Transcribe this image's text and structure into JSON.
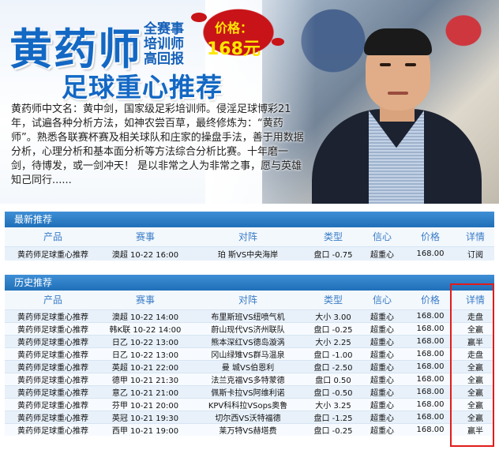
{
  "banner": {
    "title": "黄药师",
    "subtitle_lines": [
      "全赛事",
      "培训师",
      "高回报"
    ],
    "price_label": "价格：",
    "price_value": "168元",
    "headline": "足球重心推荐",
    "intro": "黄药师中文名：黄中剑，国家级足彩培训师。侵淫足球博彩21年，试遍各种分析方法，如神农尝百草，最终修炼为：“黄药师”。熟悉各联赛杯赛及相关球队和庄家的操盘手法，善于用数据分析，心理分析和基本面分析等方法综合分析比赛。十年磨一剑，待博发，或一剑冲天！  是以非常之人为非常之事，愿与英雄知己同行......"
  },
  "latest": {
    "section_title": "最新推荐",
    "headers": [
      "产品",
      "赛事",
      "对阵",
      "类型",
      "信心",
      "价格",
      "详情"
    ],
    "rows": [
      {
        "product": "黄药师足球重心推荐",
        "match": "澳超 10-22 16:00",
        "teams": "珀 斯VS中央海岸",
        "type": "盘口 -0.75",
        "confidence": "超重心",
        "price": "168.00",
        "detail": "订阅"
      }
    ]
  },
  "history": {
    "section_title": "历史推荐",
    "headers": [
      "产品",
      "赛事",
      "对阵",
      "类型",
      "信心",
      "价格",
      "详情"
    ],
    "rows": [
      {
        "product": "黄药师足球重心推荐",
        "match": "澳超 10-22 14:00",
        "teams": "布里斯班VS纽喷气机",
        "type": "大小 3.00",
        "confidence": "超重心",
        "price": "168.00",
        "detail": "走盘"
      },
      {
        "product": "黄药师足球重心推荐",
        "match": "韩K联 10-22 14:00",
        "teams": "蔚山现代VS济州联队",
        "type": "盘口 -0.25",
        "confidence": "超重心",
        "price": "168.00",
        "detail": "全赢"
      },
      {
        "product": "黄药师足球重心推荐",
        "match": "日乙 10-22 13:00",
        "teams": "熊本深红VS德岛漩涡",
        "type": "大小 2.25",
        "confidence": "超重心",
        "price": "168.00",
        "detail": "赢半"
      },
      {
        "product": "黄药师足球重心推荐",
        "match": "日乙 10-22 13:00",
        "teams": "冈山绿雉VS群马温泉",
        "type": "盘口 -1.00",
        "confidence": "超重心",
        "price": "168.00",
        "detail": "走盘"
      },
      {
        "product": "黄药师足球重心推荐",
        "match": "英超 10-21 22:00",
        "teams": "曼 城VS伯恩利",
        "type": "盘口 -2.50",
        "confidence": "超重心",
        "price": "168.00",
        "detail": "全赢"
      },
      {
        "product": "黄药师足球重心推荐",
        "match": "德甲 10-21 21:30",
        "teams": "法兰克福VS多特蒙德",
        "type": "盘口 0.50",
        "confidence": "超重心",
        "price": "168.00",
        "detail": "全赢"
      },
      {
        "product": "黄药师足球重心推荐",
        "match": "意乙 10-21 21:00",
        "teams": "佩斯卡拉VS阿维利诺",
        "type": "盘口 -0.50",
        "confidence": "超重心",
        "price": "168.00",
        "detail": "全赢"
      },
      {
        "product": "黄药师足球重心推荐",
        "match": "芬甲 10-21 20:00",
        "teams": "KPV科科拉VSops奥鲁",
        "type": "大小 3.25",
        "confidence": "超重心",
        "price": "168.00",
        "detail": "全赢"
      },
      {
        "product": "黄药师足球重心推荐",
        "match": "英冠 10-21 19:30",
        "teams": "切尔西VS沃特福德",
        "type": "盘口 -1.25",
        "confidence": "超重心",
        "price": "168.00",
        "detail": "全赢"
      },
      {
        "product": "黄药师足球重心推荐",
        "match": "西甲 10-21 19:00",
        "teams": "莱万特VS赫塔费",
        "type": "盘口 -0.25",
        "confidence": "超重心",
        "price": "168.00",
        "detail": "赢半"
      }
    ]
  },
  "colors": {
    "brand_blue": "#1368c4",
    "header_bar": "#2a7ac4",
    "row_alt": "#e8f1fa",
    "highlight": "#e21b1b",
    "price_yellow": "#ffe600",
    "price_red": "#c81418"
  }
}
